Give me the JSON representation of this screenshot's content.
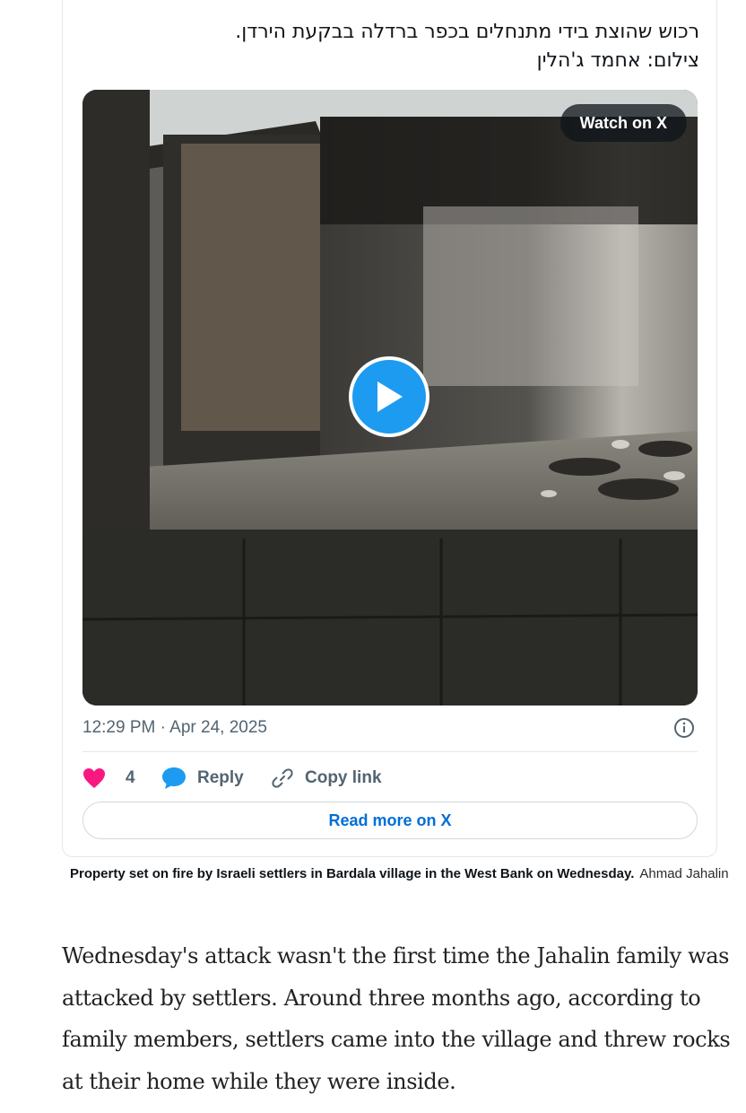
{
  "tweet": {
    "text_line1": "רכוש שהוצת בידי מתנחלים בכפר ברדלה בבקעת הירדן.",
    "text_line2": "צילום: אחמד ג'הלין",
    "watch_label": "Watch on X",
    "timestamp": "12:29 PM · Apr 24, 2025",
    "like_count": "4",
    "reply_label": "Reply",
    "copy_label": "Copy link",
    "read_more_label": "Read more on X",
    "colors": {
      "like": "#f91880",
      "accent": "#1d9bf0",
      "link": "#006fd6"
    },
    "icons": [
      "heart-icon",
      "reply-bubble-icon",
      "link-icon",
      "info-icon",
      "play-icon"
    ]
  },
  "caption": {
    "main": "Property set on fire by Israeli settlers in Bardala village in the West Bank on Wednesday.",
    "credit": "Ahmad Jahalin"
  },
  "article": {
    "paragraph": "Wednesday's attack wasn't the first time the Jahalin family was attacked by settlers. Around three months ago, according to family members, settlers came into the village and threw rocks at their home while they were inside."
  }
}
